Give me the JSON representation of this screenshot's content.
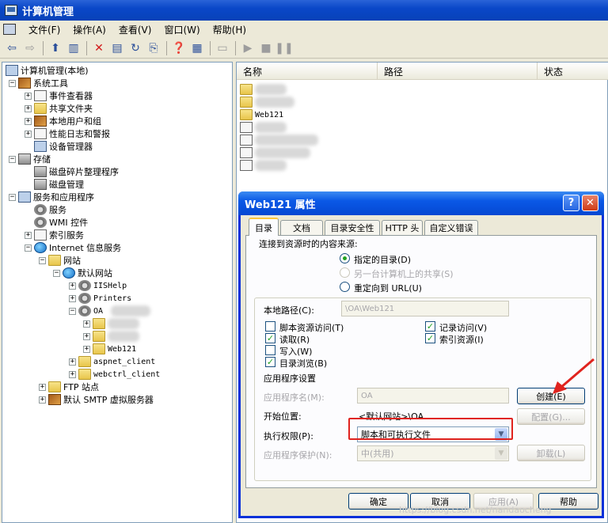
{
  "window": {
    "title": "计算机管理"
  },
  "menubar": {
    "items": [
      "文件(F)",
      "操作(A)",
      "查看(V)",
      "窗口(W)",
      "帮助(H)"
    ]
  },
  "tree": {
    "root": "计算机管理(本地)",
    "system_tools": "系统工具",
    "event_viewer": "事件查看器",
    "shared_folders": "共享文件夹",
    "local_users": "本地用户和组",
    "perf_logs": "性能日志和警报",
    "device_manager": "设备管理器",
    "storage": "存储",
    "defrag": "磁盘碎片整理程序",
    "disk_mgmt": "磁盘管理",
    "services_apps": "服务和应用程序",
    "services": "服务",
    "wmi": "WMI 控件",
    "indexing": "索引服务",
    "iis": "Internet 信息服务",
    "websites": "网站",
    "default_site": "默认网站",
    "iishelp": "IISHelp",
    "printers": "Printers",
    "oa": "OA",
    "web121": "Web121",
    "aspnet_client": "aspnet_client",
    "webctrl_client": "webctrl_client",
    "ftp": "FTP 站点",
    "smtp": "默认 SMTP 虚拟服务器"
  },
  "list": {
    "columns": [
      "名称",
      "路径",
      "状态"
    ],
    "visible_item": "Web121"
  },
  "dialog": {
    "title": "Web121 属性",
    "help_btn": "?",
    "close_btn": "✕",
    "tabs": [
      "目录",
      "文档",
      "目录安全性",
      "HTTP 头",
      "自定义错误"
    ],
    "content_source_label": "连接到资源时的内容来源:",
    "radio_dir": "指定的目录(D)",
    "radio_share": "另一台计算机上的共享(S)",
    "radio_url": "重定向到 URL(U)",
    "local_path_label": "本地路径(C):",
    "local_path_value": "\\OA\\Web121",
    "cb_script_access": "脚本资源访问(T)",
    "cb_read": "读取(R)",
    "cb_write": "写入(W)",
    "cb_browse": "目录浏览(B)",
    "cb_log": "记录访问(V)",
    "cb_index": "索引资源(I)",
    "app_settings_label": "应用程序设置",
    "app_name_label": "应用程序名(M):",
    "app_name_value": "OA",
    "create_btn": "创建(E)",
    "start_point_label": "开始位置:",
    "start_point_value": "<默认网站>\\OA",
    "config_btn": "配置(G)...",
    "exec_perm_label": "执行权限(P):",
    "exec_perm_value": "脚本和可执行文件",
    "app_protect_label": "应用程序保护(N):",
    "app_protect_value": "中(共用)",
    "unload_btn": "卸载(L)",
    "ok_btn": "确定",
    "cancel_btn": "取消",
    "apply_btn": "应用(A)",
    "help_bottom_btn": "帮助"
  },
  "watermark": "https://blog.csdn.net/nandaocheng"
}
